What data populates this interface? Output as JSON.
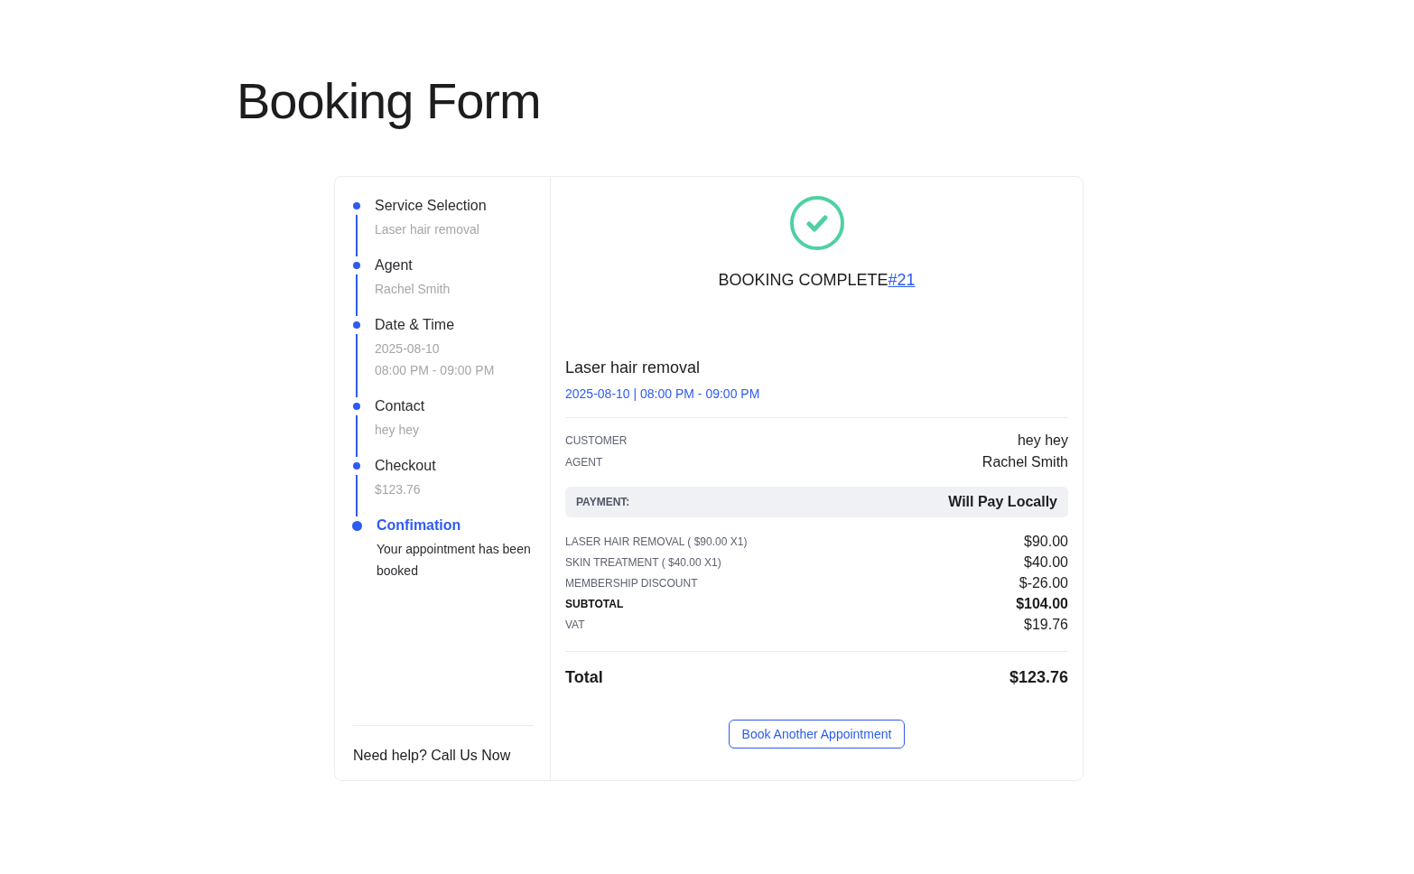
{
  "page_title": "Booking Form",
  "steps": [
    {
      "title": "Service Selection",
      "details": [
        "Laser hair removal"
      ],
      "selected": false
    },
    {
      "title": "Agent",
      "details": [
        "Rachel Smith"
      ],
      "selected": false
    },
    {
      "title": "Date & Time",
      "details": [
        "2025-08-10",
        "08:00 PM - 09:00 PM"
      ],
      "selected": false
    },
    {
      "title": "Contact",
      "details": [
        "hey hey"
      ],
      "selected": false
    },
    {
      "title": "Checkout",
      "details": [
        "$123.76"
      ],
      "selected": false
    },
    {
      "title": "Confimation",
      "details": [
        "Your appointment has been booked"
      ],
      "selected": true
    }
  ],
  "help_text": "Need help? Call Us Now",
  "confirmation": {
    "heading": "BOOKING COMPLETE",
    "booking_number": "#21"
  },
  "service": {
    "name": "Laser hair removal",
    "schedule": "2025-08-10 | 08:00 PM - 09:00 PM"
  },
  "details": [
    {
      "label": "CUSTOMER",
      "value": "hey hey"
    },
    {
      "label": "AGENT",
      "value": "Rachel Smith"
    }
  ],
  "payment": {
    "label": "PAYMENT:",
    "value": "Will Pay Locally"
  },
  "line_items": [
    {
      "label": "LASER HAIR REMOVAL ( $90.00 X1)",
      "amount": "$90.00",
      "kind": "item"
    },
    {
      "label": "SKIN TREATMENT ( $40.00 X1)",
      "amount": "$40.00",
      "kind": "item"
    },
    {
      "label": "MEMBERSHIP DISCOUNT",
      "amount": "$-26.00",
      "kind": "item"
    },
    {
      "label": "SUBTOTAL",
      "amount": "$104.00",
      "kind": "subtotal"
    },
    {
      "label": "VAT",
      "amount": "$19.76",
      "kind": "item"
    }
  ],
  "total": {
    "label": "Total",
    "amount": "$123.76"
  },
  "button": "Book Another Appointment"
}
